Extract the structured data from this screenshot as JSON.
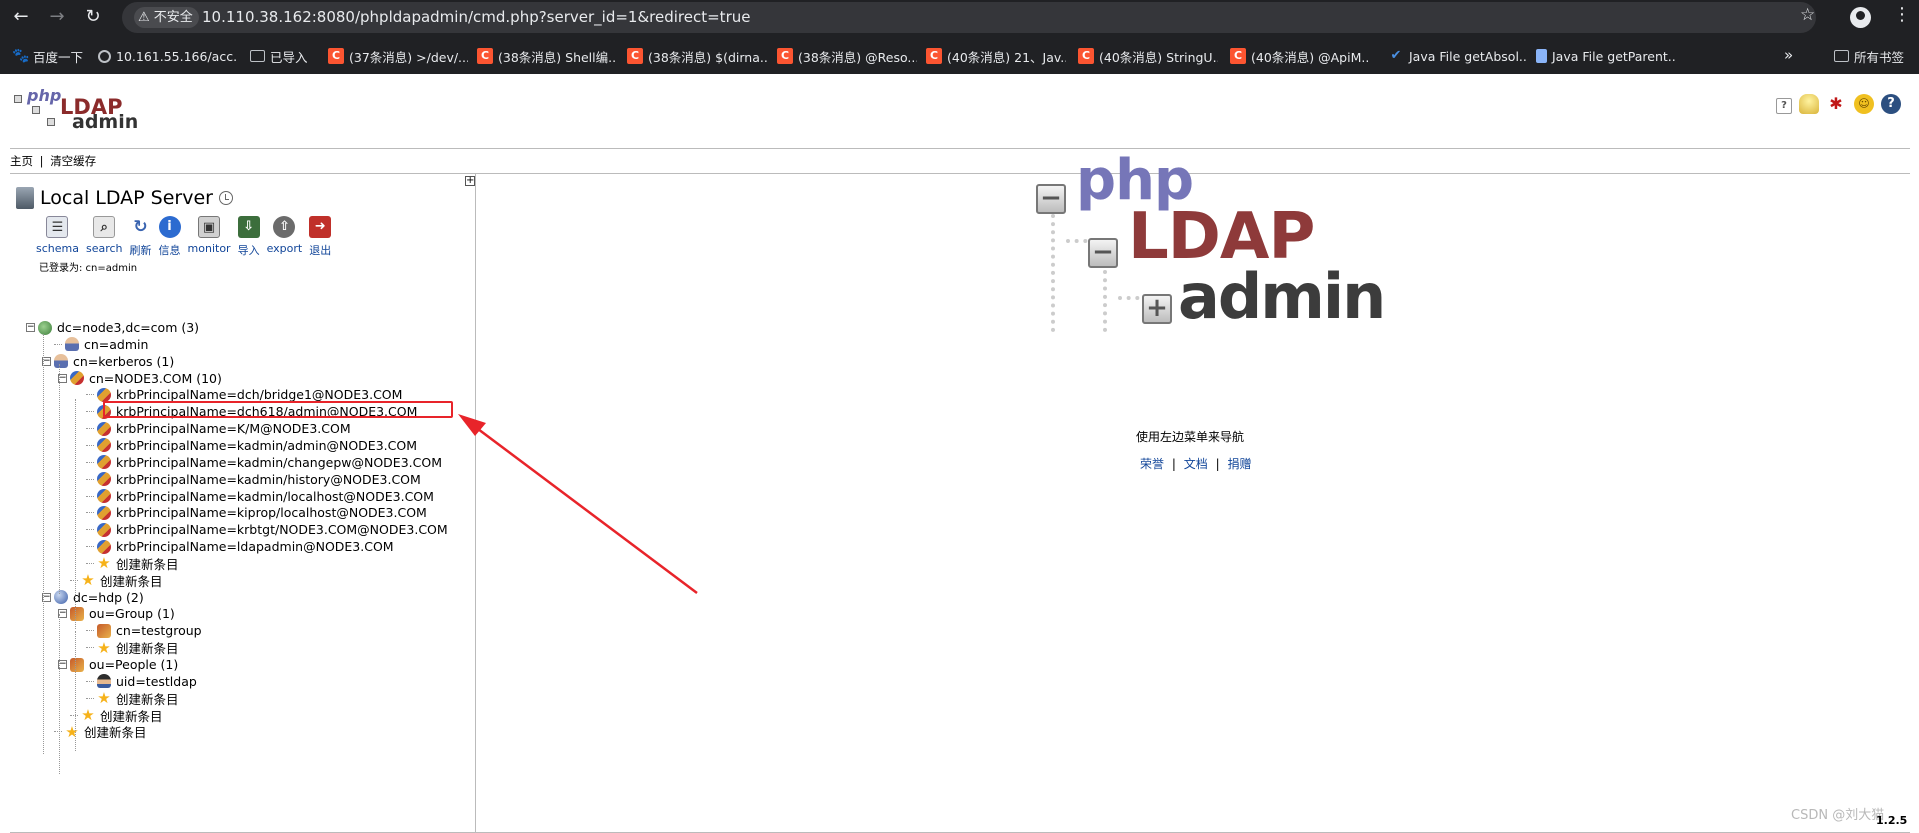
{
  "browser": {
    "insecure_label": "不安全",
    "url": "10.110.38.162:8080/phpldapadmin/cmd.php?server_id=1&redirect=true",
    "bookmarks": [
      {
        "label": "百度一下",
        "icon": "paw-icon"
      },
      {
        "label": "10.161.55.166/acc...",
        "icon": "globe-icon"
      },
      {
        "label": "已导入",
        "icon": "folder-icon"
      },
      {
        "label": "(37条消息) >/dev/...",
        "icon": "csdn-icon"
      },
      {
        "label": "(38条消息) Shell编...",
        "icon": "csdn-icon"
      },
      {
        "label": "(38条消息) $(dirna...",
        "icon": "csdn-icon"
      },
      {
        "label": "(38条消息) @Reso...",
        "icon": "csdn-icon"
      },
      {
        "label": "(40条消息) 21、Jav...",
        "icon": "csdn-icon"
      },
      {
        "label": "(40条消息) StringU...",
        "icon": "csdn-icon"
      },
      {
        "label": "(40条消息) @ApiM...",
        "icon": "csdn-icon"
      },
      {
        "label": "Java File getAbsol...",
        "icon": "check-icon"
      },
      {
        "label": "Java File getParent...",
        "icon": "doc-icon"
      }
    ],
    "more": "»",
    "all_bookmarks": "所有书签"
  },
  "app": {
    "topbar": {
      "home": "主页",
      "sep": "|",
      "purge": "清空缓存"
    },
    "server_title": "Local LDAP Server",
    "tools": [
      {
        "label": "schema",
        "icon": "schema-icon",
        "color": "#5b6b7c"
      },
      {
        "label": "search",
        "icon": "search-icon",
        "color": "#7a7a7a"
      },
      {
        "label": "刷新",
        "icon": "refresh-icon",
        "color": "#3a64b0"
      },
      {
        "label": "信息",
        "icon": "info-icon",
        "color": "#2c6bd0"
      },
      {
        "label": "monitor",
        "icon": "monitor-icon",
        "color": "#555555"
      },
      {
        "label": "导入",
        "icon": "import-icon",
        "color": "#3c6e3c"
      },
      {
        "label": "export",
        "icon": "export-icon",
        "color": "#6b6b6b"
      },
      {
        "label": "退出",
        "icon": "logout-icon",
        "color": "#c0302a"
      }
    ],
    "logged_in": "已登录为: cn=admin",
    "tree": [
      {
        "label": "dc=node3,dc=com (3)",
        "icon": "net",
        "level": 0,
        "exp": "−"
      },
      {
        "label": "cn=admin",
        "icon": "person",
        "level": 1
      },
      {
        "label": "cn=kerberos (1)",
        "icon": "person",
        "level": 1,
        "exp": "−"
      },
      {
        "label": "cn=NODE3.COM (10)",
        "icon": "group",
        "level": 2,
        "exp": "−"
      },
      {
        "label": "krbPrincipalName=dch/bridge1@NODE3.COM",
        "icon": "group",
        "level": 3
      },
      {
        "label": "krbPrincipalName=dch618/admin@NODE3.COM",
        "icon": "group",
        "level": 3
      },
      {
        "label": "krbPrincipalName=K/M@NODE3.COM",
        "icon": "group",
        "level": 3
      },
      {
        "label": "krbPrincipalName=kadmin/admin@NODE3.COM",
        "icon": "group",
        "level": 3
      },
      {
        "label": "krbPrincipalName=kadmin/changepw@NODE3.COM",
        "icon": "group",
        "level": 3
      },
      {
        "label": "krbPrincipalName=kadmin/history@NODE3.COM",
        "icon": "group",
        "level": 3
      },
      {
        "label": "krbPrincipalName=kadmin/localhost@NODE3.COM",
        "icon": "group",
        "level": 3
      },
      {
        "label": "krbPrincipalName=kiprop/localhost@NODE3.COM",
        "icon": "group",
        "level": 3
      },
      {
        "label": "krbPrincipalName=krbtgt/NODE3.COM@NODE3.COM",
        "icon": "group",
        "level": 3
      },
      {
        "label": "krbPrincipalName=ldapadmin@NODE3.COM",
        "icon": "group",
        "level": 3
      },
      {
        "label": "创建新条目",
        "icon": "star",
        "level": 3
      },
      {
        "label": "创建新条目",
        "icon": "star",
        "level": 2
      },
      {
        "label": "dc=hdp (2)",
        "icon": "globe",
        "level": 1,
        "exp": "−"
      },
      {
        "label": "ou=Group (1)",
        "icon": "ou",
        "level": 2,
        "exp": "−"
      },
      {
        "label": "cn=testgroup",
        "icon": "ou",
        "level": 3
      },
      {
        "label": "创建新条目",
        "icon": "star",
        "level": 3
      },
      {
        "label": "ou=People (1)",
        "icon": "ou",
        "level": 2,
        "exp": "−"
      },
      {
        "label": "uid=testldap",
        "icon": "user",
        "level": 3
      },
      {
        "label": "创建新条目",
        "icon": "star",
        "level": 3
      },
      {
        "label": "创建新条目",
        "icon": "star",
        "level": 2
      },
      {
        "label": "创建新条目",
        "icon": "star",
        "level": 1
      }
    ],
    "logo": {
      "php": "php",
      "ldap": "LDAP",
      "admin": "admin"
    },
    "nav_message": "使用左边菜单来导航",
    "links": [
      {
        "label": "荣誉"
      },
      {
        "label": "文档"
      },
      {
        "label": "捐赠"
      }
    ],
    "link_sep": "|",
    "version": "1.2.5",
    "watermark": "CSDN @刘大猫"
  }
}
